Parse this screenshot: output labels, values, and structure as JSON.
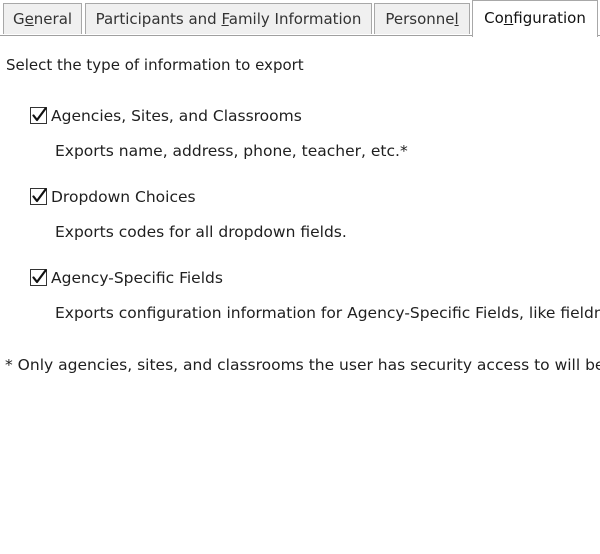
{
  "tabs": [
    {
      "prefix": "G",
      "mnemonic": "e",
      "suffix": "neral",
      "active": false
    },
    {
      "prefix": "Participants and ",
      "mnemonic": "F",
      "suffix": "amily Information",
      "active": false
    },
    {
      "prefix": "Personne",
      "mnemonic": "l",
      "suffix": "",
      "active": false
    },
    {
      "prefix": "Co",
      "mnemonic": "n",
      "suffix": "figuration",
      "active": true
    }
  ],
  "export": {
    "heading": "Select the type of information to export",
    "options": [
      {
        "label": "Agencies, Sites, and Classrooms",
        "description": "Exports name, address, phone, teacher, etc.*",
        "checked": true
      },
      {
        "label": "Dropdown Choices",
        "description": "Exports codes for all dropdown fields.",
        "checked": true
      },
      {
        "label": "Agency-Specific Fields",
        "description": "Exports configuration information for Agency-Specific Fields, like fieldna",
        "checked": true
      }
    ],
    "footnote": "* Only agencies, sites, and classrooms the user has security access to will be e"
  }
}
